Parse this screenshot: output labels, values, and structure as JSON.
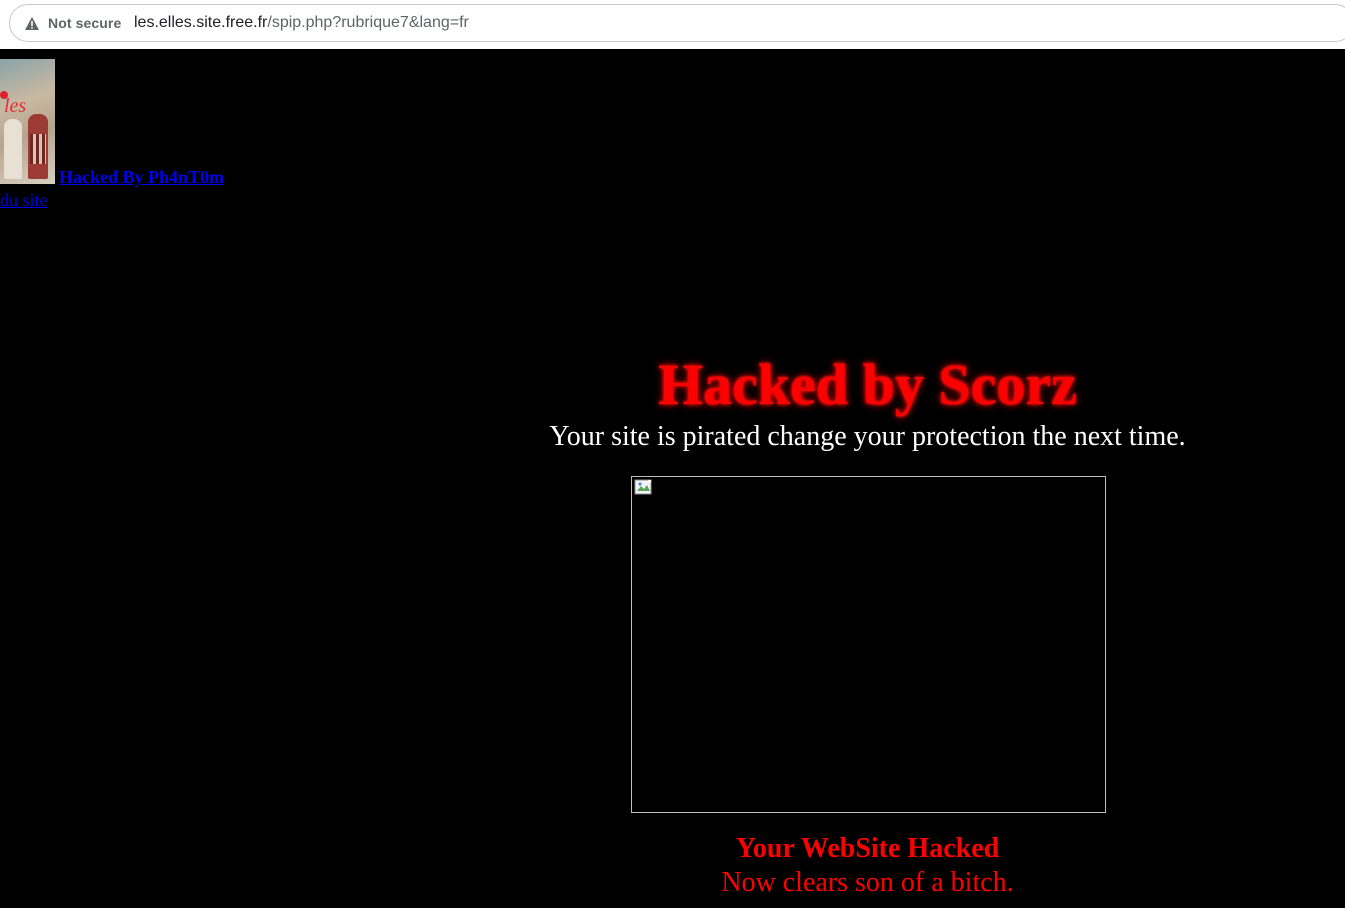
{
  "browser": {
    "security_label": "Not secure",
    "url_host": "les.elles.site.free.fr",
    "url_path": "/spip.php?rubrique7&lang=fr",
    "icons": {
      "security": "warning-triangle-icon"
    }
  },
  "page": {
    "background_color": "#000000",
    "logo": {
      "icon": "site-logo-image",
      "text": "les"
    },
    "links": {
      "hacked_by": "Hacked By Ph4nT0m",
      "site": "du site"
    },
    "headline": "Hacked by Scorz",
    "subline": "Your site is pirated change your protection the next time.",
    "image": {
      "icon": "broken-image-icon"
    },
    "footer_title": "Your WebSite Hacked",
    "footer_text": "Now clears son of a bitch.",
    "colors": {
      "headline": "#ff0000",
      "subline": "#ffffff",
      "link": "#0000ee"
    }
  }
}
